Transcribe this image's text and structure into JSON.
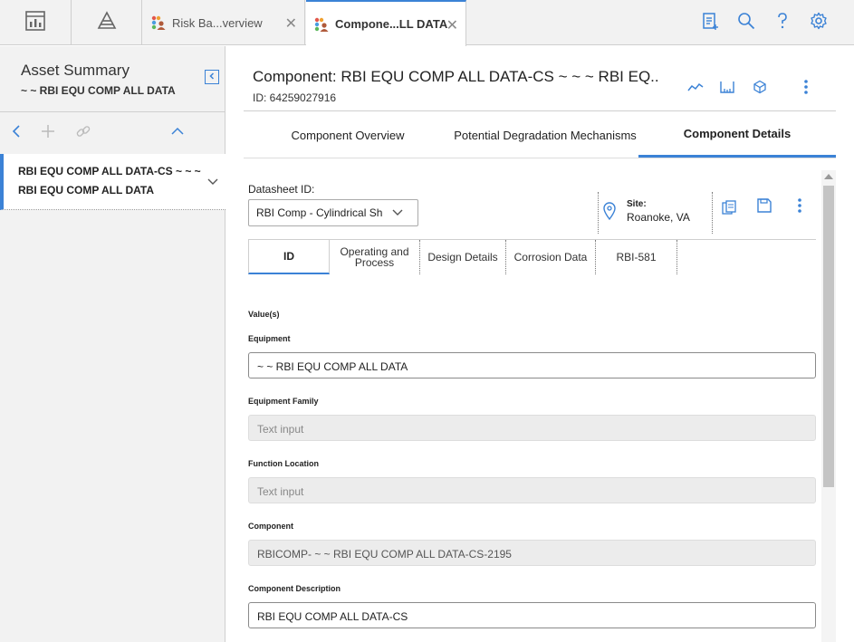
{
  "topbar": {
    "tabs": [
      {
        "label": "Risk Ba...verview",
        "close": "✕"
      },
      {
        "label": "Compone...LL DATA",
        "close": "✕"
      }
    ],
    "icons": [
      "dashboard-icon",
      "hierarchy-icon",
      "notes-icon",
      "search-icon",
      "help-icon",
      "settings-icon"
    ],
    "accent": "#3b82d6"
  },
  "sidebar": {
    "title": "Asset Summary",
    "subtitle": "~ ~ RBI EQU COMP ALL DATA",
    "items": [
      {
        "line1": "RBI EQU COMP ALL DATA-CS ~ ~ ~",
        "line2": "RBI EQU COMP ALL DATA"
      }
    ]
  },
  "header": {
    "title": "Component: RBI EQU COMP ALL DATA-CS ~ ~ ~ RBI EQ..",
    "id": "ID: 64259027916"
  },
  "main_tabs": [
    {
      "label": "Component Overview"
    },
    {
      "label": "Potential Degradation Mechanisms"
    },
    {
      "label": "Component Details",
      "active": true
    }
  ],
  "datasheet": {
    "label": "Datasheet ID:",
    "selected": "RBI Comp - Cylindrical Sh",
    "site_label": "Site:",
    "site_value": "Roanoke, VA"
  },
  "datasheet_tabs": [
    {
      "label": "ID",
      "active": true
    },
    {
      "label": "Operating and Process"
    },
    {
      "label": "Design Details"
    },
    {
      "label": "Corrosion Data"
    },
    {
      "label": "RBI-581"
    }
  ],
  "values_label": "Value(s)",
  "fields": [
    {
      "label": "Equipment",
      "value": "~  ~ RBI EQU COMP ALL DATA",
      "editable": true
    },
    {
      "label": "Equipment Family",
      "value": "",
      "placeholder": "Text input",
      "editable": false
    },
    {
      "label": "Function Location",
      "value": "",
      "placeholder": "Text input",
      "editable": false
    },
    {
      "label": "Component",
      "value": "RBICOMP- ~  ~ RBI EQU COMP ALL DATA-CS-2195",
      "editable": false
    },
    {
      "label": "Component Description",
      "value": "RBI EQU COMP ALL DATA-CS",
      "editable": true
    }
  ]
}
